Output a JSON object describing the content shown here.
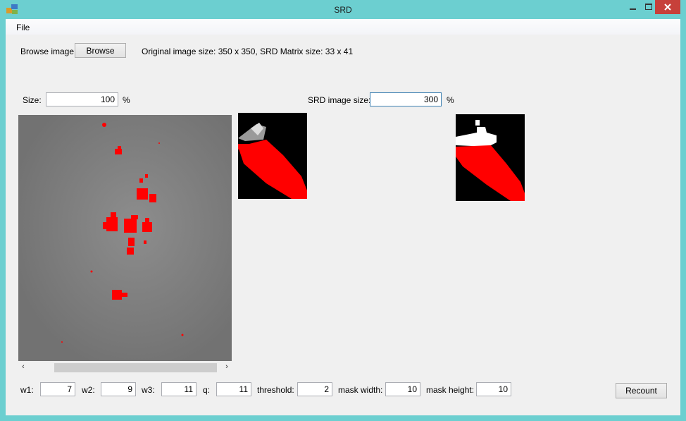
{
  "window": {
    "title": "SRD"
  },
  "icons": {
    "app": "app-icon",
    "minimize": "minimize-icon",
    "maximize": "maximize-icon",
    "close": "close-icon"
  },
  "menu": {
    "file": "File"
  },
  "browse": {
    "label": "Browse image:",
    "button": "Browse"
  },
  "info": "Original image size: 350 x 350, SRD Matrix size: 33 x 41",
  "size": {
    "label": "Size:",
    "value": "100",
    "unit": "%"
  },
  "srd_size": {
    "label": "SRD image size:",
    "value": "300",
    "unit": "%"
  },
  "params": {
    "w1": {
      "label": "w1:",
      "value": "7"
    },
    "w2": {
      "label": "w2:",
      "value": "9"
    },
    "w3": {
      "label": "w3:",
      "value": "11"
    },
    "q": {
      "label": "q:",
      "value": "11"
    },
    "threshold": {
      "label": "threshold:",
      "value": "2"
    },
    "mask_width": {
      "label": "mask width:",
      "value": "10"
    },
    "mask_height": {
      "label": "mask height:",
      "value": "10"
    }
  },
  "recount": "Recount",
  "colors": {
    "window_frame": "#6ccfd0",
    "highlight": "#ff0000",
    "close_button": "#c7403a"
  }
}
